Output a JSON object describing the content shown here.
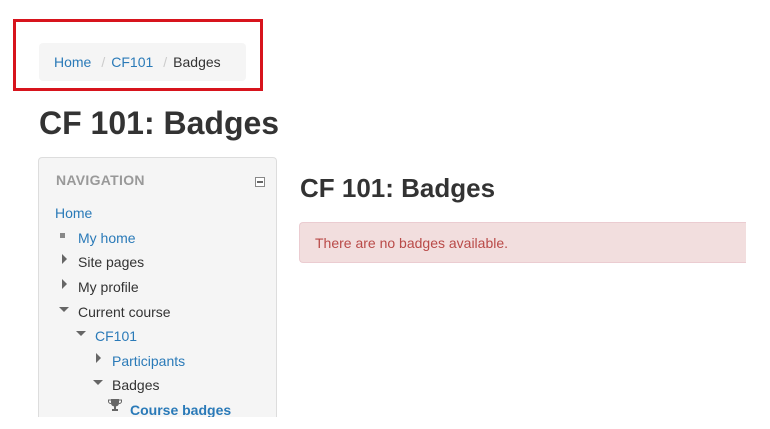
{
  "breadcrumb": {
    "items": [
      {
        "label": "Home",
        "link": true
      },
      {
        "label": "CF101",
        "link": true
      },
      {
        "label": "Badges",
        "link": false
      }
    ],
    "separator": "/"
  },
  "page": {
    "title": "CF 101: Badges"
  },
  "navigation": {
    "header": "NAVIGATION",
    "items": [
      {
        "label": "Home"
      },
      {
        "label": "My home"
      },
      {
        "label": "Site pages"
      },
      {
        "label": "My profile"
      },
      {
        "label": "Current course"
      },
      {
        "label": "CF101"
      },
      {
        "label": "Participants"
      },
      {
        "label": "Badges"
      },
      {
        "label": "Course badges"
      }
    ]
  },
  "main": {
    "title": "CF 101: Badges",
    "alert": "There are no badges available."
  },
  "colors": {
    "link": "#2a7ab8",
    "alert_bg": "#f2dede",
    "alert_text": "#b94a48",
    "highlight": "#d7141d"
  }
}
